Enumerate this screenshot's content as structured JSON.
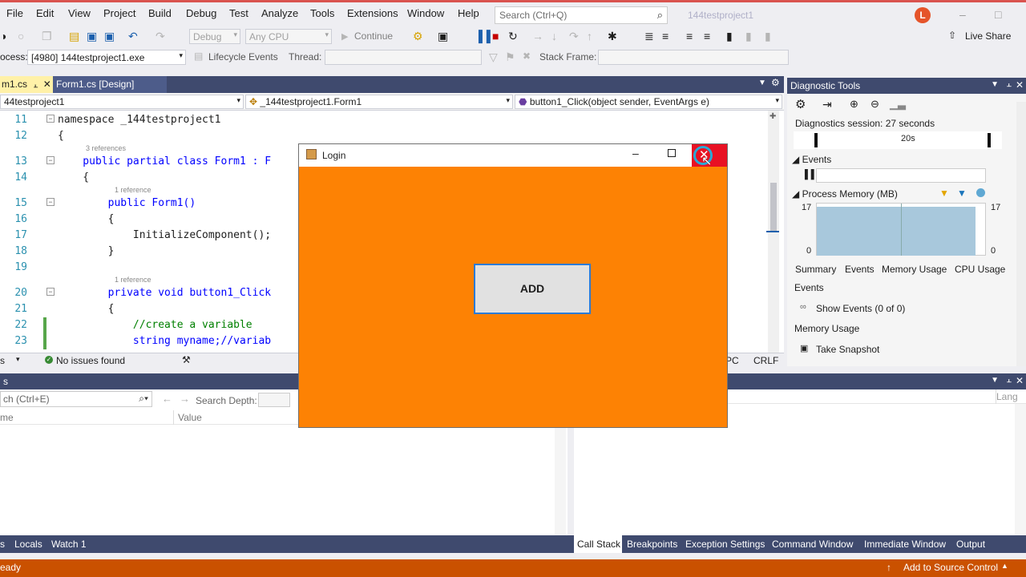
{
  "menu": {
    "items": [
      "File",
      "Edit",
      "View",
      "Project",
      "Build",
      "Debug",
      "Test",
      "Analyze",
      "Tools",
      "Extensions",
      "Window",
      "Help"
    ],
    "search_placeholder": "Search (Ctrl+Q)",
    "solution_name": "144testproject1",
    "avatar_initial": "L"
  },
  "toolbar": {
    "config": "Debug",
    "platform": "Any CPU",
    "continue_label": "Continue",
    "live_share": "Live Share",
    "process_label": "ocess:",
    "process_value": "[4980] 144testproject1.exe",
    "lifecycle_label": "Lifecycle Events",
    "thread_label": "Thread:",
    "stack_frame_label": "Stack Frame:"
  },
  "doc_tabs": [
    {
      "label": "m1.cs"
    },
    {
      "label": "Form1.cs [Design]"
    }
  ],
  "nav": {
    "project": "44testproject1",
    "class": "_144testproject1.Form1",
    "member": "button1_Click(object sender, EventArgs e)"
  },
  "code_lines": [
    {
      "no": "11",
      "text": "namespace _144testproject1"
    },
    {
      "no": "12",
      "text": "{"
    },
    {
      "no": "13",
      "text": "    public partial class Form1 : F"
    },
    {
      "no": "14",
      "text": "    {"
    },
    {
      "no": "15",
      "text": "        public Form1()"
    },
    {
      "no": "16",
      "text": "        {"
    },
    {
      "no": "17",
      "text": "            InitializeComponent();"
    },
    {
      "no": "18",
      "text": "        }"
    },
    {
      "no": "19",
      "text": ""
    },
    {
      "no": "20",
      "text": "        private void button1_Click"
    },
    {
      "no": "21",
      "text": "        {"
    },
    {
      "no": "22",
      "text": "            //create a variable"
    },
    {
      "no": "23",
      "text": "            string myname;//variab"
    }
  ],
  "refs": [
    "3 references",
    "1 reference",
    "1 reference"
  ],
  "editor_status": {
    "issues": "No issues found",
    "pc": "PC",
    "crlf": "CRLF"
  },
  "diag": {
    "title": "Diagnostic Tools",
    "session": "Diagnostics session: 27 seconds",
    "time_mark": "20s",
    "events_label": "Events",
    "memory_label": "Process Memory (MB)",
    "mem_max": "17",
    "mem_min": "0",
    "tabs": [
      "Summary",
      "Events",
      "Memory Usage",
      "CPU Usage"
    ],
    "events_header": "Events",
    "show_events": "Show Events (0 of 0)",
    "memory_header": "Memory Usage",
    "take_snapshot": "Take Snapshot"
  },
  "locals": {
    "search_placeholder": "ch (Ctrl+E)",
    "search_depth": "Search Depth:",
    "col_name": "me",
    "col_value": "Value"
  },
  "right_pane": {
    "col_lang": "Lang"
  },
  "bottom_tabs": {
    "left": [
      "s",
      "Locals",
      "Watch 1"
    ],
    "right": [
      "Call Stack",
      "Breakpoints",
      "Exception Settings",
      "Command Window",
      "Immediate Window",
      "Output"
    ]
  },
  "status": {
    "ready": "eady",
    "source_control": "Add to Source Control"
  },
  "login_form": {
    "title": "Login",
    "button_label": "ADD",
    "background": "#fd8204"
  }
}
